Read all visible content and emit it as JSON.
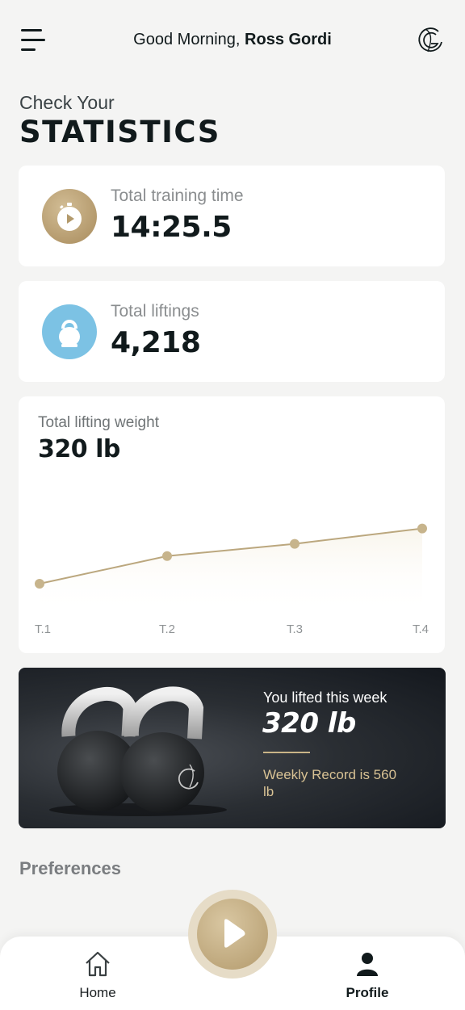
{
  "header": {
    "greeting_prefix": "Good Morning,",
    "user_name": "Ross Gordi",
    "menu_icon": "hamburger-menu-icon",
    "logo_icon": "brand-logo-icon"
  },
  "title": {
    "subtitle": "Check Your",
    "main": "STATISTICS"
  },
  "stats": [
    {
      "label": "Total training time",
      "value": "14:25.5",
      "icon": "stopwatch-icon",
      "color": "#b89a66"
    },
    {
      "label": "Total liftings",
      "value": "4,218",
      "icon": "kettlebell-icon",
      "color": "#7cc2e4"
    }
  ],
  "weight_card": {
    "label": "Total lifting weight",
    "value": "320 lb"
  },
  "chart_data": {
    "type": "line",
    "categories": [
      "T.1",
      "T.2",
      "T.3",
      "T.4"
    ],
    "values": [
      20,
      38,
      46,
      56
    ],
    "ylim": [
      0,
      100
    ],
    "xlabel": "",
    "ylabel": "",
    "grid": false,
    "color": "#bba77e"
  },
  "promo": {
    "title": "You lifted this week",
    "value": "320 lb",
    "record": "Weekly Record is 560 lb"
  },
  "preferences": {
    "title": "Preferences"
  },
  "bottom_nav": {
    "items": [
      {
        "label": "Home",
        "icon": "home-icon"
      },
      {
        "label": "Profile",
        "icon": "profile-icon"
      }
    ],
    "play_icon": "play-icon"
  },
  "colors": {
    "accent_gold": "#b89a66",
    "accent_blue": "#7cc2e4",
    "background": "#f4f4f3",
    "dark": "#111a1c"
  }
}
